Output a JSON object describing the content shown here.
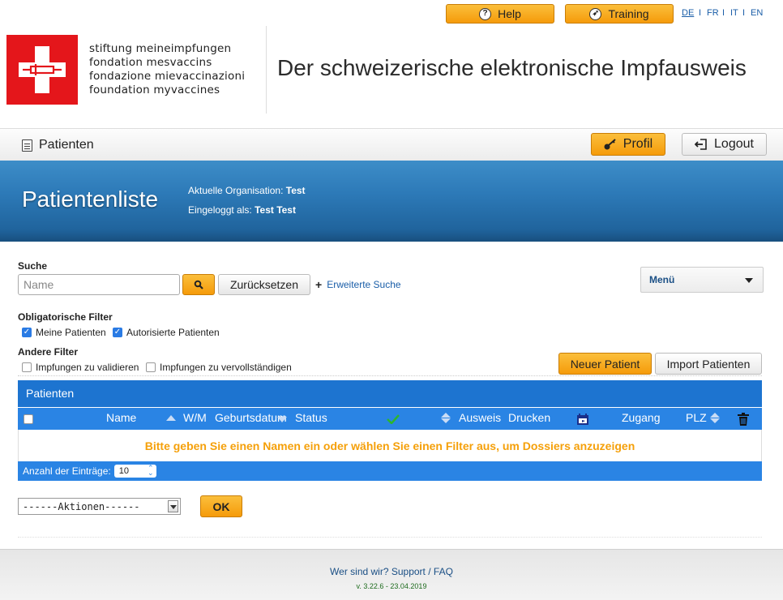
{
  "top": {
    "help_label": "Help",
    "training_label": "Training",
    "languages": [
      "DE",
      "FR",
      "IT",
      "EN"
    ],
    "active_language": "DE"
  },
  "brand": {
    "lines": [
      "stiftung meineimpfungen",
      "fondation mesvaccins",
      "fondazione mievaccinazioni",
      "foundation myvaccines"
    ],
    "site_title": "Der schweizerische elektronische Impfausweis"
  },
  "nav": {
    "patients_label": "Patienten",
    "profile_label": "Profil",
    "logout_label": "Logout"
  },
  "header": {
    "page_title": "Patientenliste",
    "org_label": "Aktuelle Organisation:",
    "org_value": "Test",
    "user_label": "Eingeloggt als:",
    "user_value": "Test Test"
  },
  "search": {
    "section_label": "Suche",
    "placeholder": "Name",
    "value": "",
    "reset_label": "Zurücksetzen",
    "extended_label": "Erweiterte Suche",
    "menu_label": "Menü"
  },
  "filters": {
    "mandatory_label": "Obligatorische Filter",
    "mandatory": [
      {
        "label": "Meine Patienten",
        "checked": true
      },
      {
        "label": "Autorisierte Patienten",
        "checked": true
      }
    ],
    "other_label": "Andere Filter",
    "other": [
      {
        "label": "Impfungen zu validieren",
        "checked": false
      },
      {
        "label": "Impfungen zu vervollständigen",
        "checked": false
      }
    ]
  },
  "buttons": {
    "new_patient": "Neuer Patient",
    "import_patients": "Import Patienten"
  },
  "table": {
    "title": "Patienten",
    "columns": [
      "Name",
      "W/M",
      "Geburtsdatum",
      "Status",
      "Ausweis",
      "Drucken",
      "Zugang",
      "PLZ"
    ],
    "empty_message": "Bitte geben Sie einen Namen ein oder wählen Sie einen Filter aus, um Dossiers anzuzeigen",
    "count_label": "Anzahl der Einträge:",
    "count_value": "10"
  },
  "actions": {
    "select_value": "------Aktionen------",
    "ok_label": "OK"
  },
  "footer": {
    "links": [
      "Wer sind wir?",
      "Support",
      "FAQ"
    ],
    "version": "v. 3.22.6 - 23.04.2019"
  },
  "colors": {
    "accent_orange": "#f59b0a",
    "header_blue": "#2d7ab8",
    "table_blue": "#2a84e4",
    "brand_red": "#e4161b"
  }
}
